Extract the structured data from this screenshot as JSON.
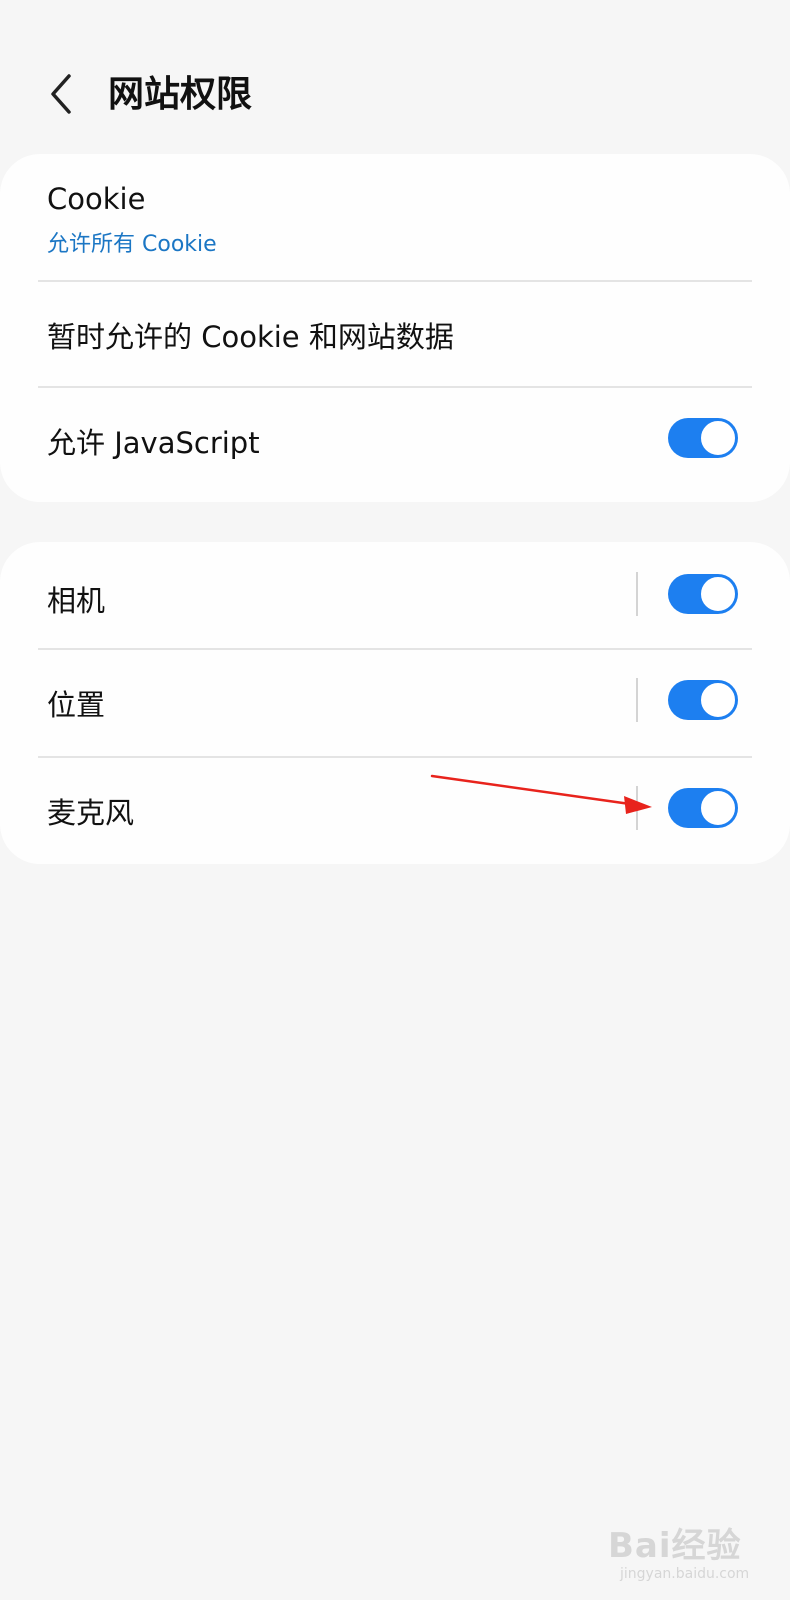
{
  "header": {
    "title": "网站权限",
    "back_icon": "chevron-left-icon"
  },
  "sections": [
    {
      "items": [
        {
          "title": "Cookie",
          "subtitle": "允许所有 Cookie"
        },
        {
          "title": "暂时允许的 Cookie 和网站数据"
        },
        {
          "title": "允许 JavaScript",
          "toggle": true
        }
      ]
    },
    {
      "items": [
        {
          "title": "相机",
          "toggle": true
        },
        {
          "title": "位置",
          "toggle": true
        },
        {
          "title": "麦克风",
          "toggle": true
        }
      ]
    }
  ],
  "annotation": {
    "icon": "red-arrow-icon",
    "color": "#e8231c"
  },
  "watermark": {
    "main": "Bai经验",
    "sub": "jingyan.baidu.com"
  },
  "colors": {
    "accent": "#1d7ff0",
    "subtitle": "#1b76c4",
    "background": "#f6f6f6",
    "card": "#fefefe"
  }
}
